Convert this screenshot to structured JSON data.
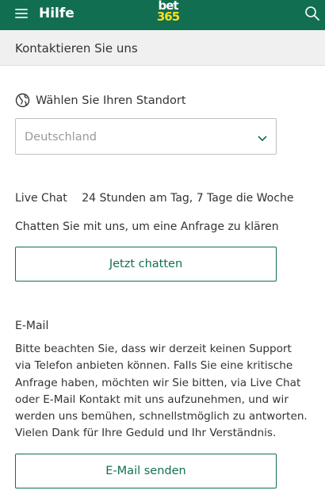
{
  "topbar": {
    "title": "Hilfe",
    "logo_top": "bet",
    "logo_bottom": "365",
    "menu_icon": "hamburger-menu-icon",
    "search_icon": "search-icon",
    "background": "#126e51",
    "logo_accent": "#ffdf1b"
  },
  "subheader": {
    "title": "Kontaktieren Sie uns"
  },
  "region": {
    "icon": "globe-icon",
    "label": "Wählen Sie Ihren Standort",
    "selected": "Deutschland"
  },
  "live_chat": {
    "label": "Live Chat",
    "hours": "24 Stunden am Tag, 7 Tage die Woche",
    "description": "Chatten Sie mit uns, um eine Anfrage zu klären",
    "button": "Jetzt chatten"
  },
  "email": {
    "title": "E-Mail",
    "body_lines": [
      "Bitte beachten Sie, dass wir derzeit keinen Support",
      "via Telefon anbieten können. Falls Sie eine kritische",
      "Anfrage haben, möchten wir Sie bitten, via Live Chat",
      "oder E-Mail Kontakt mit uns aufzunehmen, und wir",
      "werden uns bemühen, schnellstmöglich zu antworten.",
      "Vielen Dank für Ihre Geduld und Ihr Verständnis."
    ],
    "button": "E-Mail senden"
  },
  "colors": {
    "accent_green": "#126e51",
    "text": "#333333",
    "placeholder": "#9a9a9a"
  }
}
